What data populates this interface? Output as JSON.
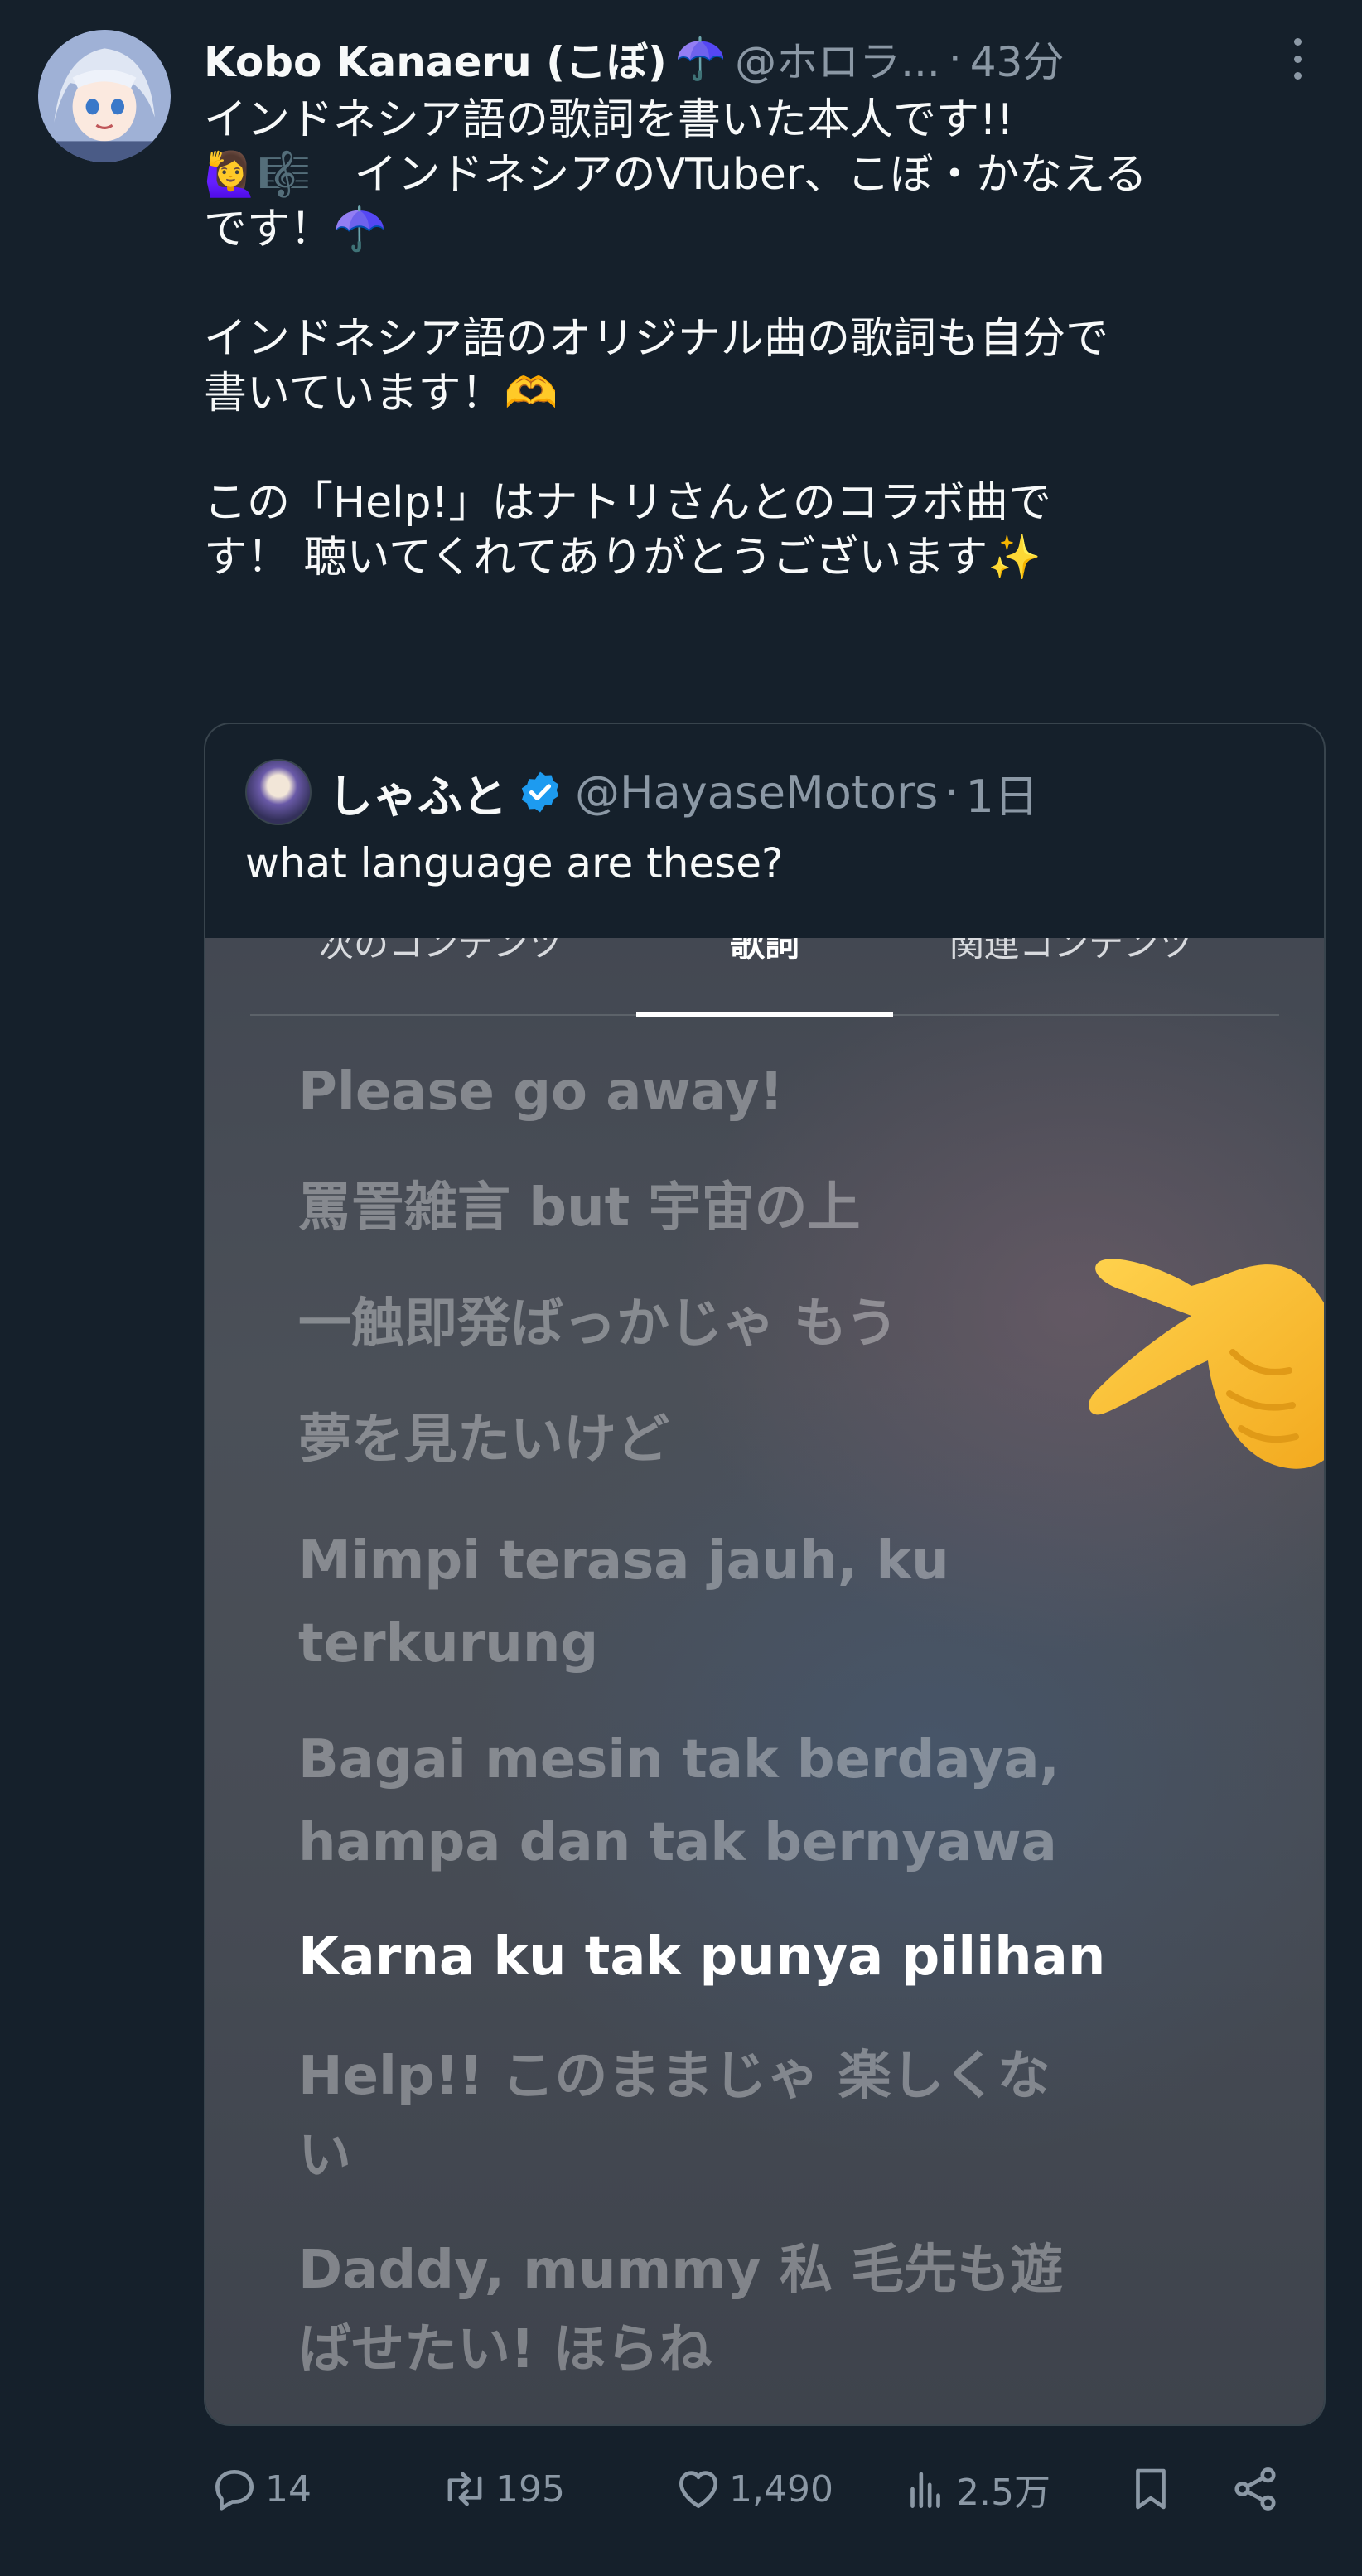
{
  "author": {
    "name": "Kobo Kanaeru (こぼ)",
    "emoji": "☂️",
    "handle": "@ホロラ...",
    "separator": "·",
    "time": "43分"
  },
  "tweet": {
    "text": "インドネシア語の歌詞を書いた本人です!!\n🙋‍♀️🎼　インドネシアのVTuber、こぼ・かなえる\nです！☂️\n\nインドネシア語のオリジナル曲の歌詞も自分で\n書いています！🫶\n\nこの「Help!」はナトリさんとのコラボ曲で\nす！ 聴いてくれてありがとうございます✨"
  },
  "quote": {
    "name": "しゃふと",
    "handle": "@HayaseMotors",
    "separator": "·",
    "time": "1日",
    "text": "what language are these?",
    "media": {
      "tabs": [
        "次のコンテンツ",
        "歌詞",
        "関連コンテンツ"
      ],
      "lyrics": [
        "Please go away!",
        "罵詈雑言 but 宇宙の上",
        "一触即発ばっかじゃ もう",
        "夢を見たいけど",
        "Mimpi terasa jauh, ku\nterkurung",
        "Bagai mesin tak berdaya,\nhampa dan tak bernyawa",
        "Karna ku tak punya pilihan",
        "Help!! このままじゃ 楽しくな\nい",
        "Daddy, mummy 私 毛先も遊\nばせたい! ほらね"
      ]
    }
  },
  "actions": {
    "replies": "14",
    "retweets": "195",
    "likes": "1,490",
    "views": "2.5万"
  },
  "colors": {
    "background": "#15202b",
    "text": "#f7f9f9",
    "secondary": "#8b98a5",
    "verified": "#1d9bf0",
    "border": "#38444d"
  }
}
